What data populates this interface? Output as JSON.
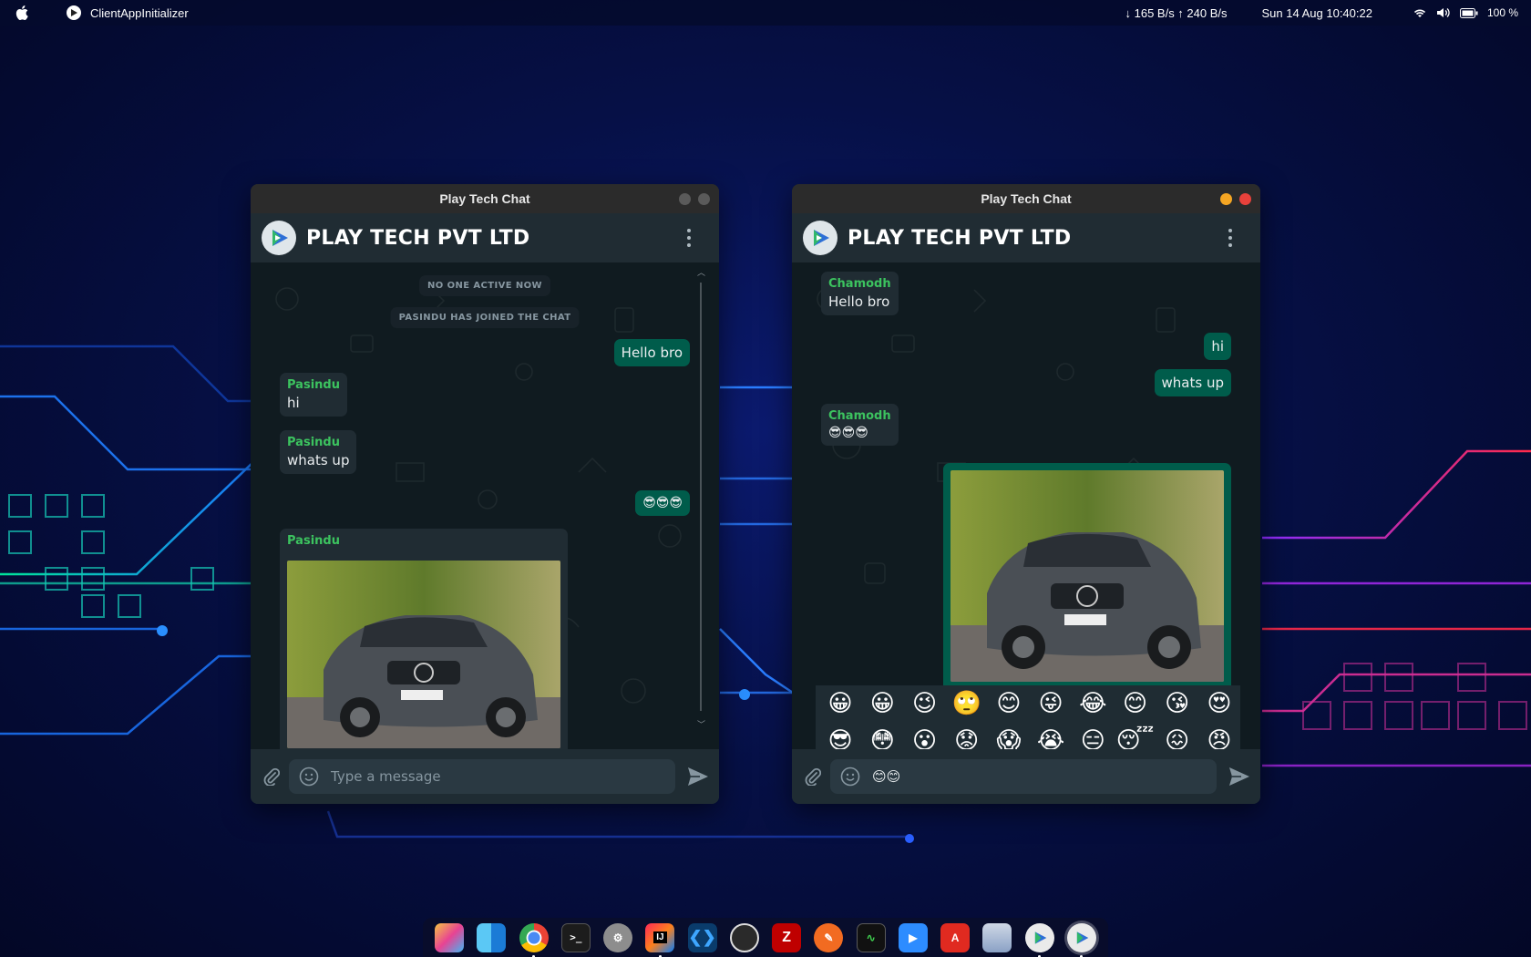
{
  "menubar": {
    "app_name": "ClientAppInitializer",
    "network": "↓ 165 B/s ↑ 240 B/s",
    "clock": "Sun 14 Aug  10:40:22",
    "battery": "100 %",
    "icons": [
      "apple-icon",
      "wifi-icon",
      "volume-icon",
      "battery-icon"
    ]
  },
  "left_window": {
    "title": "Play Tech Chat",
    "company": "PLAY TECH PVT LTD",
    "system_messages": [
      "NO ONE ACTIVE NOW",
      "PASINDU HAS JOINED THE CHAT"
    ],
    "messages": [
      {
        "direction": "out",
        "text": "Hello bro"
      },
      {
        "direction": "in",
        "sender": "Pasindu",
        "text": "hi"
      },
      {
        "direction": "in",
        "sender": "Pasindu",
        "text": "whats up"
      },
      {
        "direction": "out",
        "text": "😎😎😎"
      },
      {
        "direction": "in",
        "sender": "Pasindu",
        "image": "car-photo"
      }
    ],
    "input": {
      "placeholder": "Type a message",
      "value": ""
    }
  },
  "right_window": {
    "title": "Play Tech Chat",
    "company": "PLAY TECH PVT LTD",
    "messages": [
      {
        "direction": "in",
        "sender": "Chamodh",
        "text": "Hello bro"
      },
      {
        "direction": "out",
        "text": "hi"
      },
      {
        "direction": "out",
        "text": "whats up"
      },
      {
        "direction": "in",
        "sender": "Chamodh",
        "text": "😎😎😎"
      },
      {
        "direction": "out",
        "image": "car-photo"
      }
    ],
    "emoji_picker": [
      "😀",
      "😀",
      "😉",
      "🙄",
      "😊",
      "😜",
      "😂",
      "😊",
      "😘",
      "😍",
      "😎",
      "😳",
      "😮",
      "😟",
      "😱",
      "😭",
      "😑",
      "😴",
      "😖",
      "😠"
    ],
    "input": {
      "placeholder": "Type a message",
      "value": "😊😊"
    }
  },
  "colors": {
    "incoming_bubble": "#202c33",
    "outgoing_bubble": "#005c4b",
    "sender_name": "#3cc35f",
    "chat_background": "#101b20"
  },
  "dock": {
    "apps": [
      "launchpad-icon",
      "finder-icon",
      "chrome-icon",
      "terminal-icon",
      "settings-icon",
      "intellij-icon",
      "vscode-icon",
      "obs-icon",
      "filezilla-icon",
      "pencil-icon",
      "activity-monitor-icon",
      "zoom-icon",
      "pdf-icon",
      "preview-icon",
      "playtech-icon",
      "playtech-icon-active"
    ]
  }
}
